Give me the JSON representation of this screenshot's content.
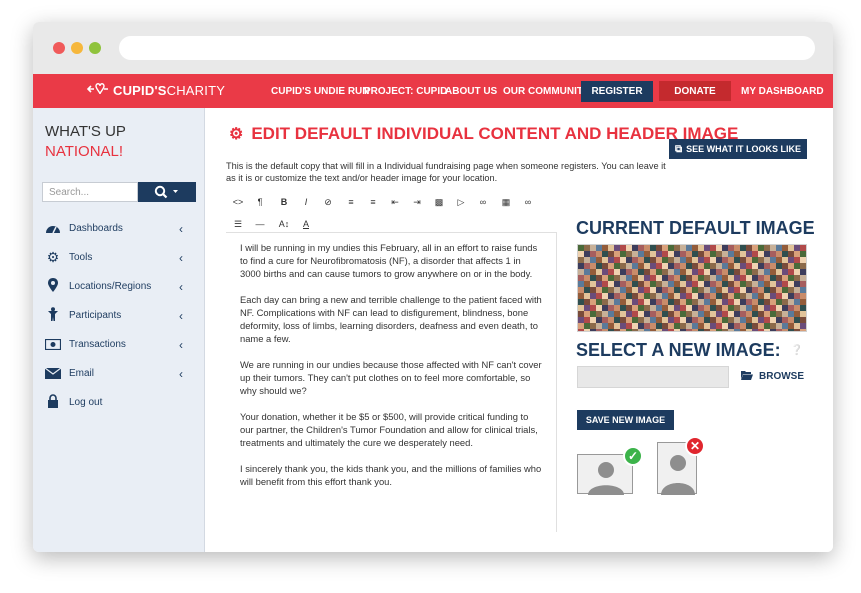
{
  "brand": {
    "name_bold": "CUPID'S",
    "name_light": "CHARITY"
  },
  "nav": {
    "items": [
      "CUPID'S UNDIE RUN",
      "PROJECT: CUPID",
      "ABOUT US",
      "OUR COMMUNITY"
    ],
    "register": "REGISTER",
    "donate": "DONATE",
    "dashboard": "MY DASHBOARD"
  },
  "sidebar": {
    "heading_line1": "WHAT'S UP",
    "heading_line2": "NATIONAL!",
    "search_placeholder": "Search...",
    "items": [
      {
        "label": "Dashboards",
        "icon": "dashboard-icon"
      },
      {
        "label": "Tools",
        "icon": "gear-icon"
      },
      {
        "label": "Locations/Regions",
        "icon": "map-pin-icon"
      },
      {
        "label": "Participants",
        "icon": "person-icon"
      },
      {
        "label": "Transactions",
        "icon": "money-icon"
      },
      {
        "label": "Email",
        "icon": "envelope-icon"
      },
      {
        "label": "Log out",
        "icon": "lock-icon"
      }
    ]
  },
  "main": {
    "title": "EDIT DEFAULT INDIVIDUAL CONTENT AND HEADER IMAGE",
    "see_button": "SEE WHAT IT LOOKS LIKE",
    "intro": "This is the default copy that will fill in a Individual fundraising page when someone registers. You can leave it as it is or customize the text and/or header image for your location.",
    "editor_paragraphs": [
      "I will be running in my undies this February, all in an effort to raise funds to find a cure for Neurofibromatosis (NF), a disorder that affects 1 in 3000 births and can cause tumors to grow anywhere on or in the body.",
      "Each day can bring a new and terrible challenge to the patient faced with NF. Complications with NF can lead to disfigurement, blindness, bone deformity, loss of limbs, learning disorders, deafness and even death, to name a few.",
      "We are running in our undies because those affected with NF can't cover up their tumors. They can't put clothes on to feel more comfortable, so why should we?",
      "Your donation, whether it be $5 or $500, will provide critical funding to our partner, the Children's Tumor Foundation and allow for clinical trials, treatments and ultimately the cure we desperately need.",
      "I sincerely thank you, the kids thank you, and the millions of families who will benefit from this effort thank you."
    ],
    "current_image_title": "CURRENT DEFAULT IMAGE",
    "select_image_title": "SELECT A NEW IMAGE:",
    "browse": "BROWSE",
    "save_button": "SAVE NEW IMAGE"
  },
  "colors": {
    "brand_red": "#ea3a47",
    "navy": "#1d3b5f",
    "donate_red": "#c42a2e",
    "ok_green": "#3cb34a",
    "error_red": "#e0262e"
  }
}
